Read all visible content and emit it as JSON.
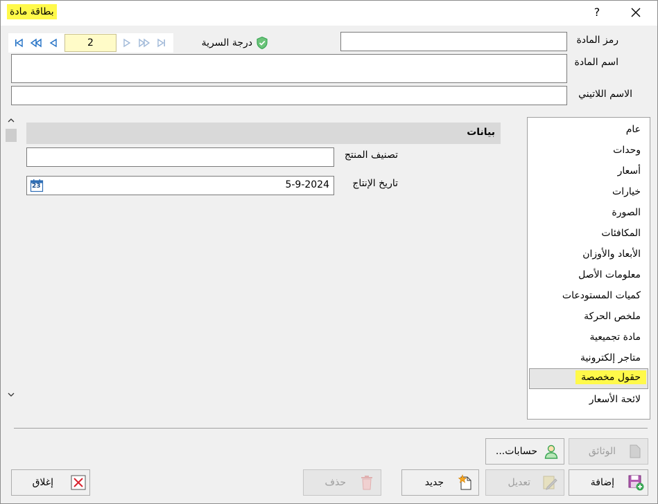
{
  "window": {
    "title": "بطاقة مادة",
    "help": "?"
  },
  "form": {
    "code_label": "رمز المادة",
    "code_value": "",
    "name_label": "اسم المادة",
    "name_value": "",
    "latin_label": "الاسم اللاتيني",
    "latin_value": "",
    "secrecy_label": "درجة السرية",
    "page_number": "2"
  },
  "section": {
    "title": "بيانات",
    "product_class_label": "تصنيف المنتج",
    "product_class_value": "",
    "production_date_label": "تاريخ الإنتاج",
    "production_date_value": "5-9-2024",
    "calendar_icon_day": "23"
  },
  "sidebar": {
    "items": [
      {
        "label": "عام"
      },
      {
        "label": "وحدات"
      },
      {
        "label": "أسعار"
      },
      {
        "label": "خيارات"
      },
      {
        "label": "الصورة"
      },
      {
        "label": "المكافئات"
      },
      {
        "label": "الأبعاد والأوزان"
      },
      {
        "label": "معلومات الأصل"
      },
      {
        "label": "كميات المستودعات"
      },
      {
        "label": "ملخص الحركة"
      },
      {
        "label": "مادة تجميعية"
      },
      {
        "label": "متاجر إلكترونية"
      },
      {
        "label": "حقول مخصصة"
      },
      {
        "label": "لائحة الأسعار"
      }
    ],
    "selected": "حقول مخصصة"
  },
  "buttons": {
    "documents": "الوثائق",
    "accounts": "حسابات...",
    "add": "إضافة",
    "edit": "تعديل",
    "new": "جديد",
    "delete": "حذف",
    "close": "إغلاق"
  },
  "colors": {
    "highlight": "#fff94a",
    "nav_blue": "#1f6fc5",
    "nav_disabled": "#9fb8d8",
    "shield_green": "#3aa655"
  }
}
